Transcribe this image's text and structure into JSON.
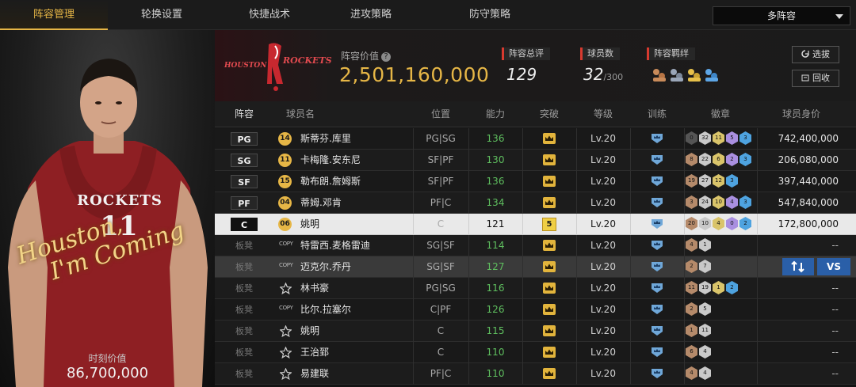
{
  "nav": {
    "tabs": [
      "阵容管理",
      "轮换设置",
      "快捷战术",
      "进攻策略",
      "防守策略"
    ],
    "active_index": 0,
    "lineup_select": "多阵容"
  },
  "card": {
    "team_jersey": "ROCKETS",
    "jersey_number": "11",
    "signature_line1": "Houston,",
    "signature_line2": "I'm Coming",
    "value_label": "时刻价值",
    "value": "86,700,000"
  },
  "team": {
    "logo_text_left": "HOUSTON",
    "logo_text_right": "ROCKETS",
    "value_label": "阵容价值",
    "value": "2,501,160,000",
    "rating_label": "阵容总评",
    "rating": "129",
    "player_count_label": "球员数",
    "player_count": "32",
    "player_count_max": "/300",
    "bond_label": "阵容羁绊",
    "buttons": {
      "scout": "选拔",
      "recycle": "回收"
    }
  },
  "table": {
    "headers": {
      "lineup": "阵容",
      "name": "球员名",
      "position": "位置",
      "ability": "能力",
      "breakthrough": "突破",
      "level": "等级",
      "training": "训练",
      "badges": "徽章",
      "value": "球员身价"
    },
    "rows": [
      {
        "slot": "PG",
        "starter": true,
        "badge_type": "number",
        "badge": "14",
        "name": "斯蒂芬.库里",
        "position": "PG|SG",
        "ability": "136",
        "breakthrough": "",
        "level": "Lv.20",
        "badges": [
          [
            "0",
            "#555"
          ],
          [
            "32",
            "#c9c9c9"
          ],
          [
            "11",
            "#d9c46a"
          ],
          [
            "5",
            "#a98fe0"
          ],
          [
            "3",
            "#4ea3e0"
          ]
        ],
        "value": "742,400,000"
      },
      {
        "slot": "SG",
        "starter": true,
        "badge_type": "number",
        "badge": "11",
        "name": "卡梅隆.安东尼",
        "position": "SF|PF",
        "ability": "130",
        "breakthrough": "",
        "level": "Lv.20",
        "badges": [
          [
            "8",
            "#b58a6a"
          ],
          [
            "22",
            "#c9c9c9"
          ],
          [
            "6",
            "#d9c46a"
          ],
          [
            "2",
            "#a98fe0"
          ],
          [
            "3",
            "#4ea3e0"
          ]
        ],
        "value": "206,080,000"
      },
      {
        "slot": "SF",
        "starter": true,
        "badge_type": "number",
        "badge": "15",
        "name": "勒布朗.詹姆斯",
        "position": "SF|PF",
        "ability": "136",
        "breakthrough": "",
        "level": "Lv.20",
        "badges": [
          [
            "19",
            "#b58a6a"
          ],
          [
            "27",
            "#c9c9c9"
          ],
          [
            "12",
            "#d9c46a"
          ],
          [
            "3",
            "#4ea3e0"
          ]
        ],
        "value": "397,440,000"
      },
      {
        "slot": "PF",
        "starter": true,
        "badge_type": "number",
        "badge": "04",
        "name": "蒂姆.邓肯",
        "position": "PF|C",
        "ability": "134",
        "breakthrough": "",
        "level": "Lv.20",
        "badges": [
          [
            "3",
            "#b58a6a"
          ],
          [
            "24",
            "#c9c9c9"
          ],
          [
            "10",
            "#d9c46a"
          ],
          [
            "4",
            "#a98fe0"
          ],
          [
            "3",
            "#4ea3e0"
          ]
        ],
        "value": "547,840,000"
      },
      {
        "slot": "C",
        "starter": true,
        "selected": true,
        "badge_type": "number",
        "badge": "06",
        "name": "姚明",
        "position": "C",
        "ability": "121",
        "breakthrough": "5",
        "level": "Lv.20",
        "badges": [
          [
            "20",
            "#b58a6a"
          ],
          [
            "10",
            "#c9c9c9"
          ],
          [
            "4",
            "#d9c46a"
          ],
          [
            "0",
            "#a98fe0"
          ],
          [
            "2",
            "#4ea3e0"
          ]
        ],
        "value": "172,800,000"
      },
      {
        "slot": "板凳",
        "starter": false,
        "badge_type": "copy",
        "badge": "COPY",
        "name": "特雷西.麦格雷迪",
        "position": "SG|SF",
        "ability": "114",
        "breakthrough": "",
        "level": "Lv.20",
        "badges": [
          [
            "4",
            "#b58a6a"
          ],
          [
            "1",
            "#c9c9c9"
          ]
        ],
        "value": "--"
      },
      {
        "slot": "板凳",
        "starter": false,
        "hover": true,
        "badge_type": "copy",
        "badge": "COPY",
        "name": "迈克尔.乔丹",
        "position": "SG|SF",
        "ability": "127",
        "breakthrough": "",
        "level": "Lv.20",
        "badges": [
          [
            "2",
            "#b58a6a"
          ],
          [
            "7",
            "#c9c9c9"
          ]
        ],
        "value": "",
        "actions": {
          "vs": "VS"
        }
      },
      {
        "slot": "板凳",
        "starter": false,
        "badge_type": "star",
        "badge": "",
        "name": "林书豪",
        "position": "PG|SG",
        "ability": "116",
        "breakthrough": "",
        "level": "Lv.20",
        "badges": [
          [
            "11",
            "#b58a6a"
          ],
          [
            "19",
            "#c9c9c9"
          ],
          [
            "1",
            "#d9c46a"
          ],
          [
            "2",
            "#4ea3e0"
          ]
        ],
        "value": "--"
      },
      {
        "slot": "板凳",
        "starter": false,
        "badge_type": "copy",
        "badge": "COPY",
        "name": "比尔.拉塞尔",
        "position": "C|PF",
        "ability": "126",
        "breakthrough": "",
        "level": "Lv.20",
        "badges": [
          [
            "2",
            "#b58a6a"
          ],
          [
            "5",
            "#c9c9c9"
          ]
        ],
        "value": "--"
      },
      {
        "slot": "板凳",
        "starter": false,
        "badge_type": "star",
        "badge": "",
        "name": "姚明",
        "position": "C",
        "ability": "115",
        "breakthrough": "",
        "level": "Lv.20",
        "badges": [
          [
            "1",
            "#b58a6a"
          ],
          [
            "11",
            "#c9c9c9"
          ]
        ],
        "value": "--"
      },
      {
        "slot": "板凳",
        "starter": false,
        "badge_type": "star",
        "badge": "",
        "name": "王治郅",
        "position": "C",
        "ability": "110",
        "breakthrough": "",
        "level": "Lv.20",
        "badges": [
          [
            "6",
            "#b58a6a"
          ],
          [
            "4",
            "#c9c9c9"
          ]
        ],
        "value": "--"
      },
      {
        "slot": "板凳",
        "starter": false,
        "badge_type": "star",
        "badge": "",
        "name": "易建联",
        "position": "PF|C",
        "ability": "110",
        "breakthrough": "",
        "level": "Lv.20",
        "badges": [
          [
            "4",
            "#b58a6a"
          ],
          [
            "4",
            "#c9c9c9"
          ]
        ],
        "value": "--"
      }
    ]
  },
  "colors": {
    "accent": "#e6b646",
    "red": "#d73a2f",
    "ability_green": "#5fbf5f",
    "action_blue": "#2a5fa8"
  }
}
